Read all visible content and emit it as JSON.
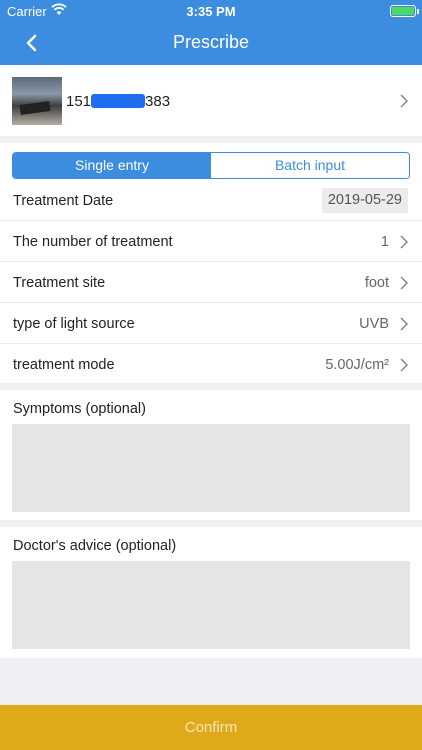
{
  "status_bar": {
    "carrier": "Carrier",
    "time": "3:35 PM"
  },
  "nav": {
    "title": "Prescribe",
    "back_icon": "chevron-left-icon"
  },
  "patient": {
    "id_prefix": "151",
    "id_suffix": "383",
    "id_masked": true
  },
  "entry_mode": {
    "options": [
      "Single entry",
      "Batch input"
    ],
    "selected": "Single entry"
  },
  "form": {
    "treatment_date": {
      "label": "Treatment Date",
      "value": "2019-05-29"
    },
    "number_of_treatment": {
      "label": "The number of treatment",
      "value": "1"
    },
    "treatment_site": {
      "label": "Treatment site",
      "value": "foot"
    },
    "light_source": {
      "label": "type of light source",
      "value": "UVB"
    },
    "treatment_mode": {
      "label": "treatment mode",
      "value": "5.00J/cm²"
    }
  },
  "symptoms": {
    "label": "Symptoms (optional)",
    "value": ""
  },
  "advice": {
    "label": "Doctor's advice (optional)",
    "value": ""
  },
  "confirm_label": "Confirm",
  "colors": {
    "primary": "#3c8ce0",
    "confirm": "#e0a919",
    "background": "#f0f0f4",
    "mask": "#1e6cf0"
  }
}
